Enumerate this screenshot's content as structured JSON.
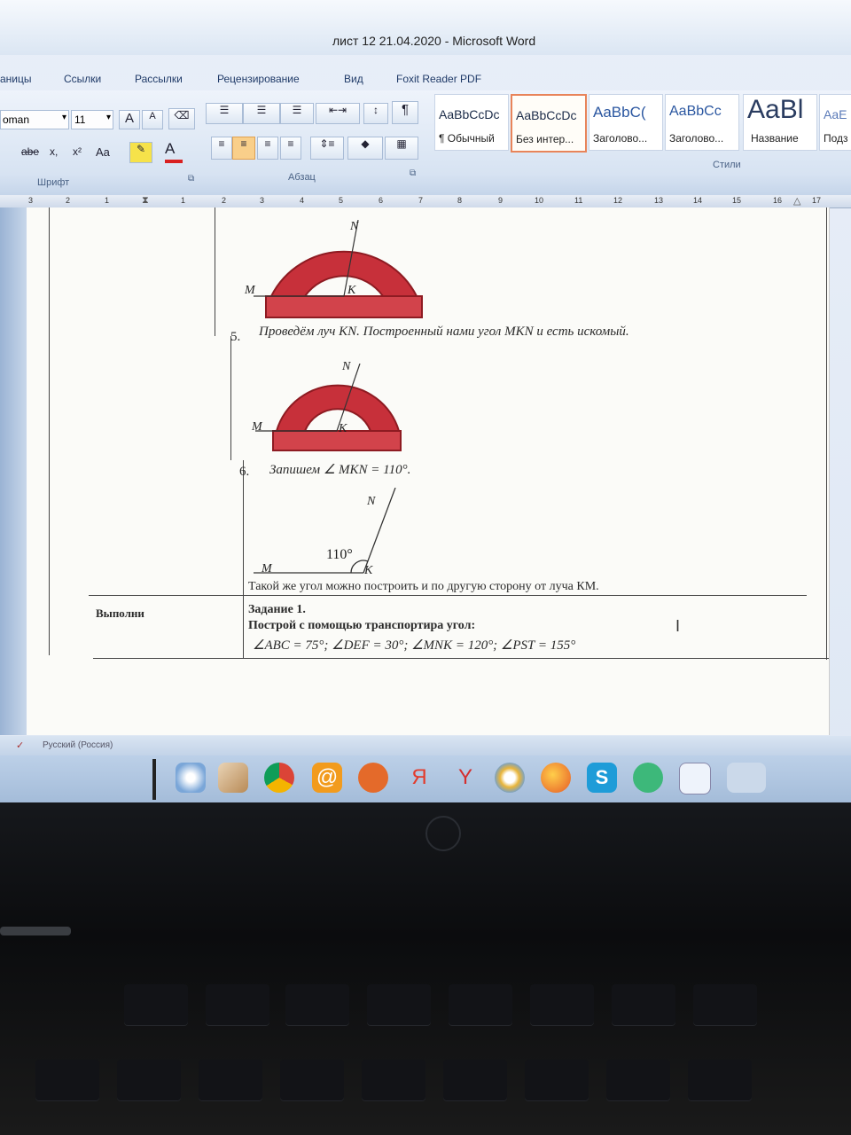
{
  "window": {
    "title": "лист 12 21.04.2020 - Microsoft Word"
  },
  "ribbon_tabs": [
    "аницы",
    "Ссылки",
    "Рассылки",
    "Рецензирование",
    "Вид",
    "Foxit Reader PDF"
  ],
  "font_group": {
    "font_name": "oman",
    "font_size": "11",
    "label": "Шрифт",
    "grow_label": "A",
    "shrink_label": "A",
    "strike_label": "abe",
    "sub_label": "x,",
    "sup_label": "x²",
    "case_label": "Aa",
    "color_label": "A"
  },
  "paragraph_group": {
    "label": "Абзац",
    "pilcrow": "¶"
  },
  "styles_group": {
    "label": "Стили",
    "tiles": [
      {
        "sample": "AaBbCcDc",
        "name": "¶ Обычный"
      },
      {
        "sample": "AaBbCcDc",
        "name": "Без интер..."
      },
      {
        "sample": "AaBbC(",
        "name": "Заголово..."
      },
      {
        "sample": "AaBbCc",
        "name": "Заголово..."
      },
      {
        "sample": "AaBl",
        "name": "Название"
      },
      {
        "sample": "AaE",
        "name": "Подз"
      }
    ]
  },
  "ruler_numbers": [
    "3",
    "2",
    "1",
    "1",
    "2",
    "3",
    "4",
    "5",
    "6",
    "7",
    "8",
    "9",
    "10",
    "11",
    "12",
    "13",
    "14",
    "15",
    "16",
    "17"
  ],
  "document": {
    "step5": {
      "num": "5.",
      "text": "Проведём луч KN. Построенный нами угол MKN и есть искомый."
    },
    "step6": {
      "num": "6.",
      "text": "Запишем ∠ MKN = 110°."
    },
    "figure1": {
      "n": "N",
      "m": "M",
      "k": "K"
    },
    "figure2": {
      "n": "N",
      "m": "M",
      "k": "K"
    },
    "figure3": {
      "n": "N",
      "m": "M",
      "k": "K",
      "angle": "110°"
    },
    "other_side": "Такой же угол можно построить и по другую сторону от луча КМ.",
    "task_row": {
      "left_label": "Выполни",
      "task_title": "Задание 1.",
      "instruction": "Построй с помощью транспортира угол:",
      "angles": "∠ABC = 75°; ∠DEF = 30°; ∠MNK = 120°; ∠PST = 155°"
    }
  },
  "statusbar": {
    "language": "Русский (Россия)"
  },
  "colors": {
    "protractor": "#c7303a",
    "protractor_dark": "#8e1b22",
    "accent_orange": "#e8845a"
  }
}
